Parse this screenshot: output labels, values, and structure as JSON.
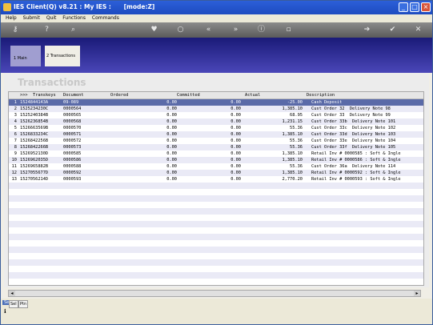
{
  "window": {
    "title": "IES Client(Q) v8.21 : My IES :      [mode:Z]"
  },
  "menu": [
    "Help",
    "Submit",
    "Quit",
    "Functions",
    "Commands"
  ],
  "toolbar_icons": [
    "key-icon",
    "help-icon",
    "search-icon",
    "heart-icon",
    "circle-icon",
    "rewind-icon",
    "fast-forward-icon",
    "info-icon",
    "save-icon",
    "forward-icon",
    "check-icon",
    "close-icon"
  ],
  "tabs": {
    "main": "1 Main",
    "transactions": "2 Transactions"
  },
  "page_title": "Transactions",
  "table": {
    "headers": {
      "marker": ">>>",
      "transkeys": "Transkeys",
      "document": "Document",
      "ordered": "Ordered",
      "committed": "Committed",
      "actual": "Actual",
      "description": "Description"
    },
    "rows": [
      {
        "n": "1",
        "key": "1524844143A",
        "doc": "09-089",
        "ordered": "0.00",
        "committed": "0.00",
        "actual": "-25.00",
        "desc": "Cash Deposit"
      },
      {
        "n": "2",
        "key": "1525234230C",
        "doc": "0000564",
        "ordered": "0.00",
        "committed": "0.00",
        "actual": "1,385.10",
        "desc": "Cust Order 32  Delivery Note 98"
      },
      {
        "n": "3",
        "key": "1525240384B",
        "doc": "0000565",
        "ordered": "0.00",
        "committed": "0.00",
        "actual": "68.95",
        "desc": "Cust Order 33  Delivery Note 99"
      },
      {
        "n": "4",
        "key": "1526236854B",
        "doc": "0000568",
        "ordered": "0.00",
        "committed": "0.00",
        "actual": "1,231.15",
        "desc": "Cust Order 33b  Delivery Note 101"
      },
      {
        "n": "5",
        "key": "1526663569B",
        "doc": "0000570",
        "ordered": "0.00",
        "committed": "0.00",
        "actual": "55.36",
        "desc": "Cust Order 33c  Delivery Note 102"
      },
      {
        "n": "6",
        "key": "1526833234C",
        "doc": "0000571",
        "ordered": "0.00",
        "committed": "0.00",
        "actual": "1,385.10",
        "desc": "Cust Order 33d  Delivery Note 103"
      },
      {
        "n": "7",
        "key": "1526842256B",
        "doc": "0000572",
        "ordered": "0.00",
        "committed": "0.00",
        "actual": "55.36",
        "desc": "Cust Order 33e  Delivery Note 104"
      },
      {
        "n": "8",
        "key": "1526842266B",
        "doc": "0000573",
        "ordered": "0.00",
        "committed": "0.00",
        "actual": "55.36",
        "desc": "Cust Order 33f  Delivery Note 105"
      },
      {
        "n": "9",
        "key": "1526952130D",
        "doc": "0000585",
        "ordered": "0.00",
        "committed": "0.00",
        "actual": "1,385.10",
        "desc": "Retail Inv # 0000585 : Soft & Ingle"
      },
      {
        "n": "10",
        "key": "1526962035D",
        "doc": "0000586",
        "ordered": "0.00",
        "committed": "0.00",
        "actual": "1,385.10",
        "desc": "Retail Inv # 0000586 : Soft & Ingle"
      },
      {
        "n": "11",
        "key": "1526965882B",
        "doc": "0000588",
        "ordered": "0.00",
        "committed": "0.00",
        "actual": "55.36",
        "desc": "Cust Order 36a  Delivery Note 114"
      },
      {
        "n": "12",
        "key": "1527055677D",
        "doc": "0000592",
        "ordered": "0.00",
        "committed": "0.00",
        "actual": "1,385.10",
        "desc": "Retail Inv # 0000592 : Soft & Ingle"
      },
      {
        "n": "13",
        "key": "1527056214D",
        "doc": "0000593",
        "ordered": "0.00",
        "committed": "0.00",
        "actual": "2,770.20",
        "desc": "Retail Inv # 0000593 : Soft & Ingle"
      }
    ]
  },
  "statusbar": {
    "left_label": "Sel",
    "btn1": "Sel",
    "btn2": "Ptn"
  },
  "colors": {
    "titlebar": "#1d4bc0",
    "banner_top": "#1a1a78",
    "banner_bottom": "#4a46b8",
    "selected_row": "#5a6aa8"
  }
}
